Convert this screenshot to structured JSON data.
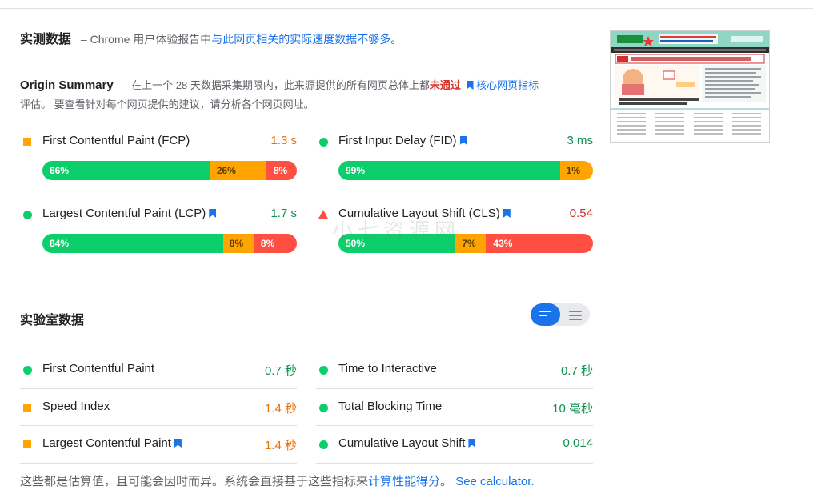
{
  "field": {
    "title": "实测数据",
    "dash": "–",
    "desc_prefix": "Chrome 用户体验报告中",
    "desc_link": "与此网页相关的实际速度数据不够多",
    "desc_suffix": "。"
  },
  "origin": {
    "title": "Origin Summary",
    "desc_prefix": "– 在上一个 28 天数据采集期限内，此来源提供的所有网页总体上都",
    "status": "未通过",
    "cwv_link": "核心网页指标",
    "desc_suffix": "评估。 要查看针对每个网页提供的建议，请分析各个网页网址。"
  },
  "metrics": [
    {
      "name": "First Contentful Paint (FCP)",
      "value": "1.3 s",
      "indicator": "average",
      "bookmark": false,
      "distribution": [
        {
          "kind": "good",
          "pct": 66,
          "label": "66%"
        },
        {
          "kind": "avg",
          "pct": 22,
          "label": "26%"
        },
        {
          "kind": "poor",
          "pct": 12,
          "label": "8%"
        }
      ]
    },
    {
      "name": "First Input Delay (FID)",
      "value": "3 ms",
      "indicator": "good",
      "bookmark": true,
      "distribution": [
        {
          "kind": "good",
          "pct": 87,
          "label": "99%"
        },
        {
          "kind": "avg",
          "pct": 13,
          "label": "1%"
        }
      ]
    },
    {
      "name": "Largest Contentful Paint (LCP)",
      "value": "1.7 s",
      "indicator": "good",
      "bookmark": true,
      "distribution": [
        {
          "kind": "good",
          "pct": 71,
          "label": "84%"
        },
        {
          "kind": "avg",
          "pct": 12,
          "label": "8%"
        },
        {
          "kind": "poor",
          "pct": 17,
          "label": "8%"
        }
      ]
    },
    {
      "name": "Cumulative Layout Shift (CLS)",
      "value": "0.54",
      "indicator": "poor",
      "bookmark": true,
      "distribution": [
        {
          "kind": "good",
          "pct": 46,
          "label": "50%"
        },
        {
          "kind": "avg",
          "pct": 12,
          "label": "7%"
        },
        {
          "kind": "poor",
          "pct": 42,
          "label": "43%"
        }
      ]
    }
  ],
  "lab": {
    "title": "实验室数据",
    "rows": [
      {
        "name": "First Contentful Paint",
        "value": "0.7 秒",
        "indicator": "good",
        "bookmark": false
      },
      {
        "name": "Time to Interactive",
        "value": "0.7 秒",
        "indicator": "good",
        "bookmark": false
      },
      {
        "name": "Speed Index",
        "value": "1.4 秒",
        "indicator": "average",
        "bookmark": false
      },
      {
        "name": "Total Blocking Time",
        "value": "10 毫秒",
        "indicator": "good",
        "bookmark": false
      },
      {
        "name": "Largest Contentful Paint",
        "value": "1.4 秒",
        "indicator": "average",
        "bookmark": true
      },
      {
        "name": "Cumulative Layout Shift",
        "value": "0.014",
        "indicator": "good",
        "bookmark": true
      }
    ]
  },
  "footer": {
    "prefix": "这些都是估算值，且可能会因时而异。系统会直接基于这些指标来",
    "link1": "计算性能得分",
    "mid": "。 ",
    "link2": "See calculator."
  },
  "watermark": "小七资源网",
  "colors": {
    "good": "#0cce6b",
    "average": "#ffa400",
    "poor": "#ff4e42",
    "link": "#1a73e8"
  }
}
